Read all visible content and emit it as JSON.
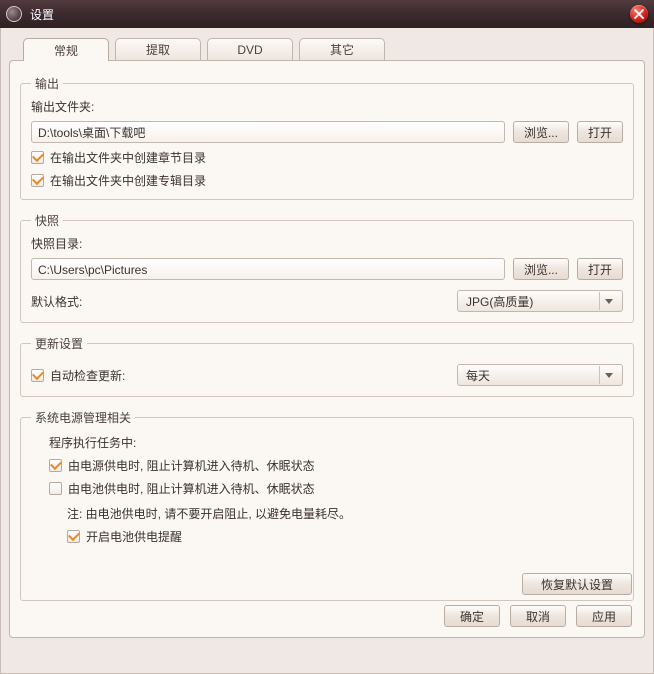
{
  "window": {
    "title": "设置"
  },
  "tabs": [
    "常规",
    "提取",
    "DVD",
    "其它"
  ],
  "active_tab_index": 0,
  "output": {
    "legend": "输出",
    "folder_label": "输出文件夹:",
    "folder_value": "D:\\tools\\桌面\\下载吧",
    "browse": "浏览...",
    "open": "打开",
    "chk_chapter": "在输出文件夹中创建章节目录",
    "chk_album": "在输出文件夹中创建专辑目录"
  },
  "snapshot": {
    "legend": "快照",
    "folder_label": "快照目录:",
    "folder_value": "C:\\Users\\pc\\Pictures",
    "browse": "浏览...",
    "open": "打开",
    "format_label": "默认格式:",
    "format_value": "JPG(高质量)"
  },
  "update": {
    "legend": "更新设置",
    "chk_label": "自动检查更新:",
    "freq_value": "每天"
  },
  "power": {
    "legend": "系统电源管理相关",
    "heading": "程序执行任务中:",
    "chk_ac": "由电源供电时, 阻止计算机进入待机、休眠状态",
    "chk_battery": "由电池供电时, 阻止计算机进入待机、休眠状态",
    "note": "注: 由电池供电时, 请不要开启阻止, 以避免电量耗尽。",
    "chk_remind": "开启电池供电提醒"
  },
  "buttons": {
    "restore": "恢复默认设置",
    "ok": "确定",
    "cancel": "取消",
    "apply": "应用"
  }
}
